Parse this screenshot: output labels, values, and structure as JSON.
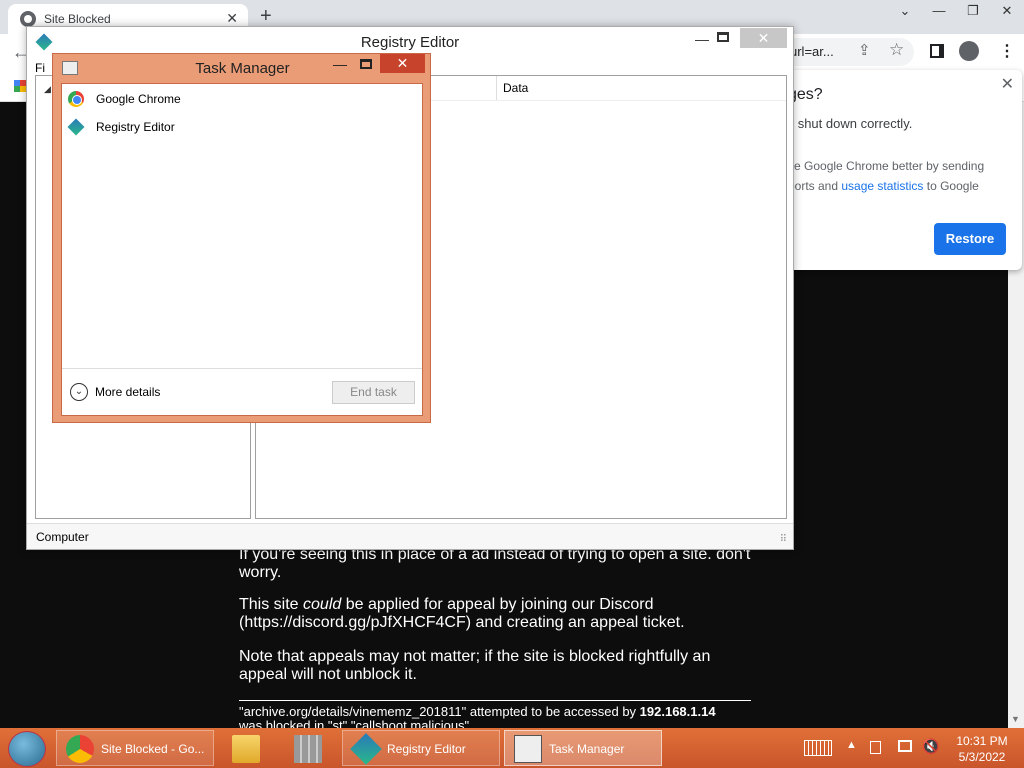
{
  "chrome": {
    "tab_title": "Site Blocked",
    "tab_close": "✕",
    "new_tab": "+",
    "window_controls": [
      "⌄",
      "—",
      "❐",
      "✕"
    ],
    "back": "←",
    "url_fragment": "url=ar...",
    "share_icon": "⇪",
    "star_icon": "☆",
    "menu_icon": "⋮"
  },
  "bubble": {
    "title": "ges?",
    "close": "✕",
    "message": "'t shut down correctly.",
    "help_prefix": "ke Google Chrome better by sending",
    "help_mid": "ports and ",
    "help_link": "usage statistics",
    "help_suffix": " to Google",
    "restore_label": "Restore"
  },
  "page": {
    "line1": "If you're seeing this in place of a ad instead of trying to open a site. don't worry.",
    "line2_pre": "This site ",
    "line2_em": "could",
    "line2_post": " be applied for appeal by joining our Discord (https://discord.gg/pJfXHCF4CF) and creating an appeal ticket.",
    "line3": "Note that appeals may not matter; if the site is blocked rightfully an appeal will not unblock it.",
    "line4_pre": "\"archive.org/details/vinememz_201811\" attempted to be accessed by ",
    "line4_ip": "192.168.1.14",
    "line5": "was blocked in \"st\" \"callshoot malicious\""
  },
  "regedit": {
    "title": "Registry Editor",
    "min": "—",
    "close": "✕",
    "menu_fragment": "Fi",
    "tree_arrow": "◢",
    "column_data": "Data",
    "status": "Computer",
    "grip": "⠿"
  },
  "taskmanager": {
    "title": "Task Manager",
    "min": "—",
    "close": "✕",
    "apps": [
      {
        "label": "Google Chrome",
        "icon": "chrome-icon"
      },
      {
        "label": "Registry Editor",
        "icon": "registry-editor-icon"
      }
    ],
    "more_details_icon": "⌄",
    "more_details": "More details",
    "end_task": "End task"
  },
  "taskbar": {
    "items": [
      {
        "label": "Site Blocked - Go...",
        "icon": "chrome-icon"
      },
      {
        "label": "",
        "icon": "file-explorer-icon"
      },
      {
        "label": "",
        "icon": "firewall-icon"
      },
      {
        "label": "Registry Editor",
        "icon": "registry-editor-icon"
      },
      {
        "label": "Task Manager",
        "icon": "task-manager-icon"
      }
    ],
    "tray_up": "▲",
    "tray_volume": "🔇",
    "time": "10:31 PM",
    "date": "5/3/2022"
  }
}
